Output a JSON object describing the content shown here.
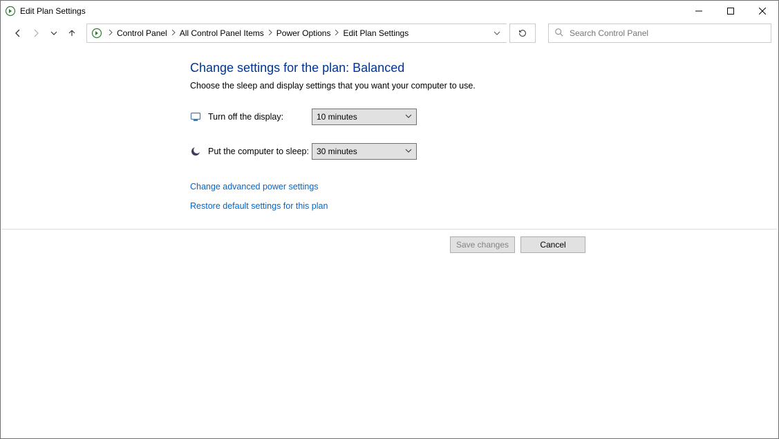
{
  "window": {
    "title": "Edit Plan Settings"
  },
  "toolbar": {
    "breadcrumbs": [
      "Control Panel",
      "All Control Panel Items",
      "Power Options",
      "Edit Plan Settings"
    ],
    "search_placeholder": "Search Control Panel"
  },
  "page": {
    "heading": "Change settings for the plan: Balanced",
    "subheading": "Choose the sleep and display settings that you want your computer to use.",
    "settings": {
      "display_label": "Turn off the display:",
      "display_value": "10 minutes",
      "sleep_label": "Put the computer to sleep:",
      "sleep_value": "30 minutes"
    },
    "links": {
      "advanced": "Change advanced power settings",
      "restore": "Restore default settings for this plan"
    },
    "buttons": {
      "save": "Save changes",
      "cancel": "Cancel"
    }
  }
}
